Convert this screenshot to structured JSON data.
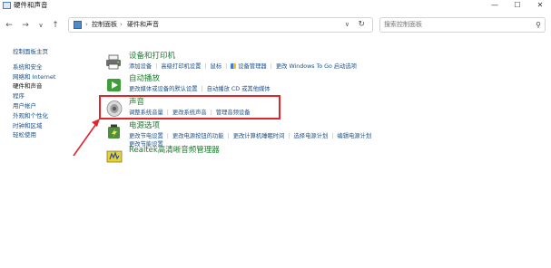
{
  "window": {
    "title": "硬件和声音",
    "controls": [
      "—",
      "☐",
      "✕"
    ]
  },
  "address": {
    "crumbs": [
      "控制面板",
      "硬件和声音"
    ],
    "separator": "›",
    "search_placeholder": "搜索控制面板"
  },
  "sidebar": {
    "home": "控制面板主页",
    "items": [
      {
        "label": "系统和安全",
        "active": false
      },
      {
        "label": "网络和 Internet",
        "active": false
      },
      {
        "label": "硬件和声音",
        "active": true
      },
      {
        "label": "程序",
        "active": false
      },
      {
        "label": "用户帐户",
        "active": false
      },
      {
        "label": "外观和个性化",
        "active": false
      },
      {
        "label": "时钟和区域",
        "active": false
      },
      {
        "label": "轻松使用",
        "active": false
      }
    ]
  },
  "categories": {
    "devices": {
      "title": "设备和打印机",
      "links": [
        "添加设备",
        "高级打印机设置",
        "鼠标",
        "设备管理器",
        "更改 Windows To Go 启动选项"
      ]
    },
    "autoplay": {
      "title": "自动播放",
      "links": [
        "更改媒体或设备的默认设置",
        "自动播放 CD 或其他媒体"
      ]
    },
    "sound": {
      "title": "声音",
      "links": [
        "调整系统音量",
        "更改系统声音",
        "管理音频设备"
      ]
    },
    "power": {
      "title": "电源选项",
      "links_line1": [
        "更改节电设置",
        "更改电源按钮的功能",
        "更改计算机睡眠时间",
        "选择电源计划",
        "编辑电源计划"
      ],
      "links_line2": [
        "更改节能设置"
      ]
    },
    "realtek": {
      "title": "Realtek高清晰音频管理器"
    }
  },
  "colors": {
    "highlight": "#e0252b",
    "link": "#1a4f8a",
    "category_title": "#1c7a2e"
  }
}
